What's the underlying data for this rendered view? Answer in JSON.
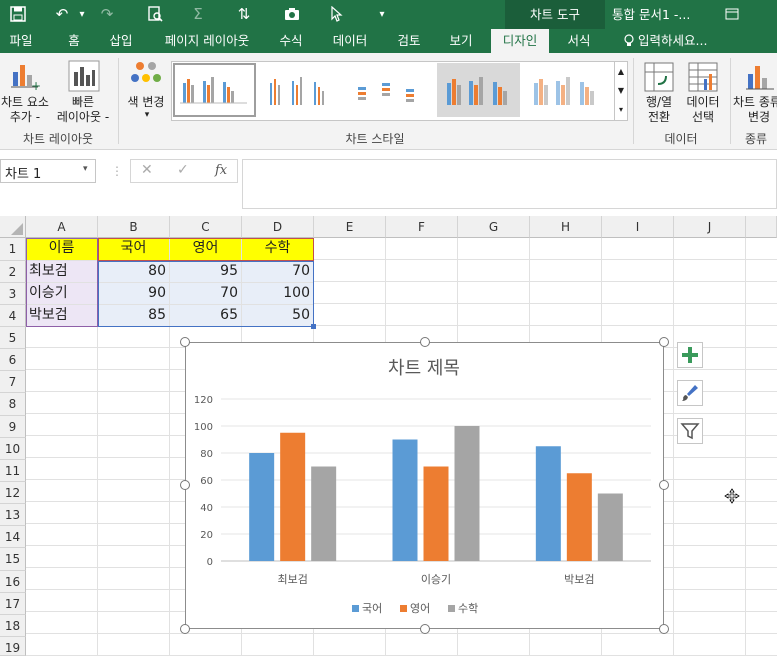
{
  "titlebar": {
    "context_tab": "차트 도구",
    "doc_title": "통합 문서1 -..."
  },
  "tabs": [
    {
      "label": "파일"
    },
    {
      "label": "홈"
    },
    {
      "label": "삽입"
    },
    {
      "label": "페이지 레이아웃"
    },
    {
      "label": "수식"
    },
    {
      "label": "데이터"
    },
    {
      "label": "검토"
    },
    {
      "label": "보기"
    },
    {
      "label": "디자인"
    },
    {
      "label": "서식"
    }
  ],
  "tell_me": "입력하세요...",
  "ribbon": {
    "add_element_1": "차트 요소",
    "add_element_2": "추가 -",
    "quick_layout_1": "빠른",
    "quick_layout_2": "레이아웃 -",
    "change_colors": "색 변경",
    "group_layouts": "차트 레이아웃",
    "group_styles": "차트 스타일",
    "switch_rowcol_1": "행/열",
    "switch_rowcol_2": "전환",
    "select_data_1": "데이터",
    "select_data_2": "선택",
    "group_data": "데이터",
    "change_type_1": "차트 종류",
    "change_type_2": "변경",
    "group_type": "종류"
  },
  "namebox": "차트 1",
  "fx_label": "fx",
  "columns": [
    "A",
    "B",
    "C",
    "D",
    "E",
    "F",
    "G",
    "H",
    "I",
    "J"
  ],
  "rows": [
    "1",
    "2",
    "3",
    "4",
    "5",
    "6",
    "7",
    "8",
    "9",
    "10",
    "11",
    "12",
    "13",
    "14",
    "15",
    "16",
    "17",
    "18",
    "19"
  ],
  "table": {
    "header": [
      "이름",
      "국어",
      "영어",
      "수학"
    ],
    "rows": [
      [
        "최보검",
        "80",
        "95",
        "70"
      ],
      [
        "이승기",
        "90",
        "70",
        "100"
      ],
      [
        "박보검",
        "85",
        "65",
        "50"
      ]
    ]
  },
  "colors": {
    "series1": "#5b9bd5",
    "series2": "#ed7d31",
    "series3": "#a5a5a5",
    "brand": "#217346",
    "header_fill": "#ffff00"
  },
  "chart_data": {
    "type": "bar",
    "title": "차트 제목",
    "categories": [
      "최보검",
      "이승기",
      "박보검"
    ],
    "series": [
      {
        "name": "국어",
        "values": [
          80,
          90,
          85
        ]
      },
      {
        "name": "영어",
        "values": [
          95,
          70,
          65
        ]
      },
      {
        "name": "수학",
        "values": [
          70,
          100,
          50
        ]
      }
    ],
    "ylim": [
      0,
      120
    ],
    "yticks": [
      "0",
      "20",
      "40",
      "60",
      "80",
      "100",
      "120"
    ],
    "grid": true,
    "legend": "bottom"
  }
}
